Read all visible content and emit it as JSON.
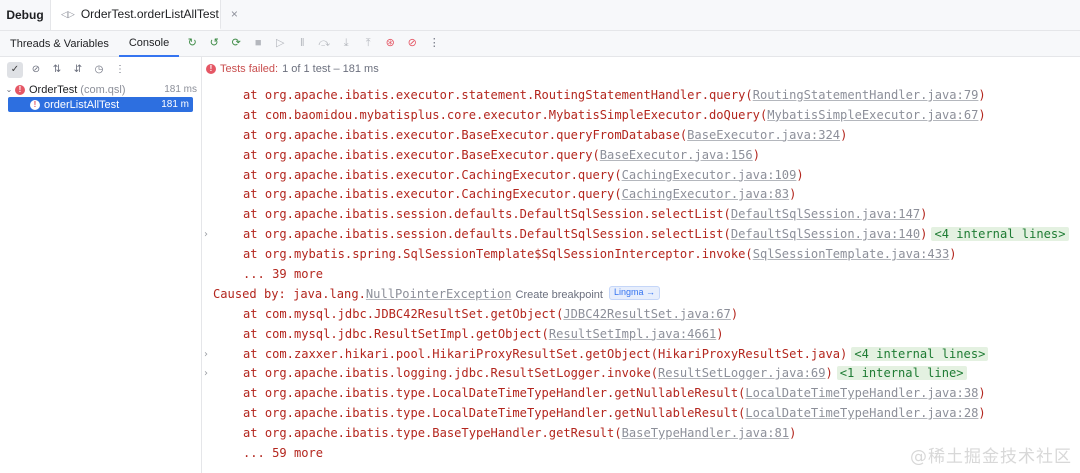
{
  "tabs": {
    "debug_label": "Debug",
    "run_tab_label": "OrderTest.orderListAllTest",
    "run_tab_close": "×"
  },
  "subtabs": {
    "threads": "Threads & Variables",
    "console": "Console"
  },
  "toolbar_icons": [
    "rerun-icon",
    "rerun-failed-icon",
    "restart-icon",
    "stop-icon",
    "resume-icon",
    "pause-icon",
    "step-over-icon",
    "step-into-icon",
    "step-out-icon",
    "view-breakpoints-icon",
    "mute-breakpoints-icon",
    "more-icon"
  ],
  "test_tree": {
    "root": {
      "name": "OrderTest",
      "package": "(com.qsl)",
      "time": "181 ms"
    },
    "child": {
      "name": "orderListAllTest",
      "time": "181 m"
    }
  },
  "status": {
    "failed_text": "Tests failed:",
    "detail_text": "1 of 1 test – 181 ms"
  },
  "console_lines": [
    {
      "kind": "frame",
      "prefix": "at org.apache.ibatis.executor.statement.RoutingStatementHandler.query(",
      "link": "RoutingStatementHandler.java:79",
      "suffix": ")"
    },
    {
      "kind": "frame",
      "prefix": "at com.baomidou.mybatisplus.core.executor.MybatisSimpleExecutor.doQuery(",
      "link": "MybatisSimpleExecutor.java:67",
      "suffix": ")"
    },
    {
      "kind": "frame",
      "prefix": "at org.apache.ibatis.executor.BaseExecutor.queryFromDatabase(",
      "link": "BaseExecutor.java:324",
      "suffix": ")"
    },
    {
      "kind": "frame",
      "prefix": "at org.apache.ibatis.executor.BaseExecutor.query(",
      "link": "BaseExecutor.java:156",
      "suffix": ")"
    },
    {
      "kind": "frame",
      "prefix": "at org.apache.ibatis.executor.CachingExecutor.query(",
      "link": "CachingExecutor.java:109",
      "suffix": ")"
    },
    {
      "kind": "frame",
      "prefix": "at org.apache.ibatis.executor.CachingExecutor.query(",
      "link": "CachingExecutor.java:83",
      "suffix": ")"
    },
    {
      "kind": "frame",
      "prefix": "at org.apache.ibatis.session.defaults.DefaultSqlSession.selectList(",
      "link": "DefaultSqlSession.java:147",
      "suffix": ")"
    },
    {
      "kind": "frame",
      "expandable": true,
      "prefix": "at org.apache.ibatis.session.defaults.DefaultSqlSession.selectList(",
      "link": "DefaultSqlSession.java:140",
      "suffix": ")",
      "internal": "<4 internal lines>"
    },
    {
      "kind": "frame",
      "prefix": "at org.mybatis.spring.SqlSessionTemplate$SqlSessionInterceptor.invoke(",
      "link": "SqlSessionTemplate.java:433",
      "suffix": ")"
    },
    {
      "kind": "more",
      "prefix": "... 39 more"
    },
    {
      "kind": "caused",
      "prefix": "Caused by: java.lang.",
      "link": "NullPointerException",
      "hint": "Create breakpoint",
      "lingma": "Lingma →"
    },
    {
      "kind": "frame",
      "prefix": "at com.mysql.jdbc.JDBC42ResultSet.getObject(",
      "link": "JDBC42ResultSet.java:67",
      "suffix": ")"
    },
    {
      "kind": "frame",
      "prefix": "at com.mysql.jdbc.ResultSetImpl.getObject(",
      "link": "ResultSetImpl.java:4661",
      "suffix": ")"
    },
    {
      "kind": "frame",
      "expandable": true,
      "prefix": "at com.zaxxer.hikari.pool.HikariProxyResultSet.getObject(HikariProxyResultSet.java)",
      "internal": "<4 internal lines>"
    },
    {
      "kind": "frame",
      "expandable": true,
      "prefix": "at org.apache.ibatis.logging.jdbc.ResultSetLogger.invoke(",
      "link": "ResultSetLogger.java:69",
      "suffix": ")",
      "internal": "<1 internal line>"
    },
    {
      "kind": "frame",
      "prefix": "at org.apache.ibatis.type.LocalDateTimeTypeHandler.getNullableResult(",
      "link": "LocalDateTimeTypeHandler.java:38",
      "suffix": ")"
    },
    {
      "kind": "frame",
      "prefix": "at org.apache.ibatis.type.LocalDateTimeTypeHandler.getNullableResult(",
      "link": "LocalDateTimeTypeHandler.java:28",
      "suffix": ")"
    },
    {
      "kind": "frame",
      "prefix": "at org.apache.ibatis.type.BaseTypeHandler.getResult(",
      "link": "BaseTypeHandler.java:81",
      "suffix": ")"
    },
    {
      "kind": "more",
      "prefix": "... 59 more"
    }
  ],
  "watermark": "@稀土掘金技术社区"
}
